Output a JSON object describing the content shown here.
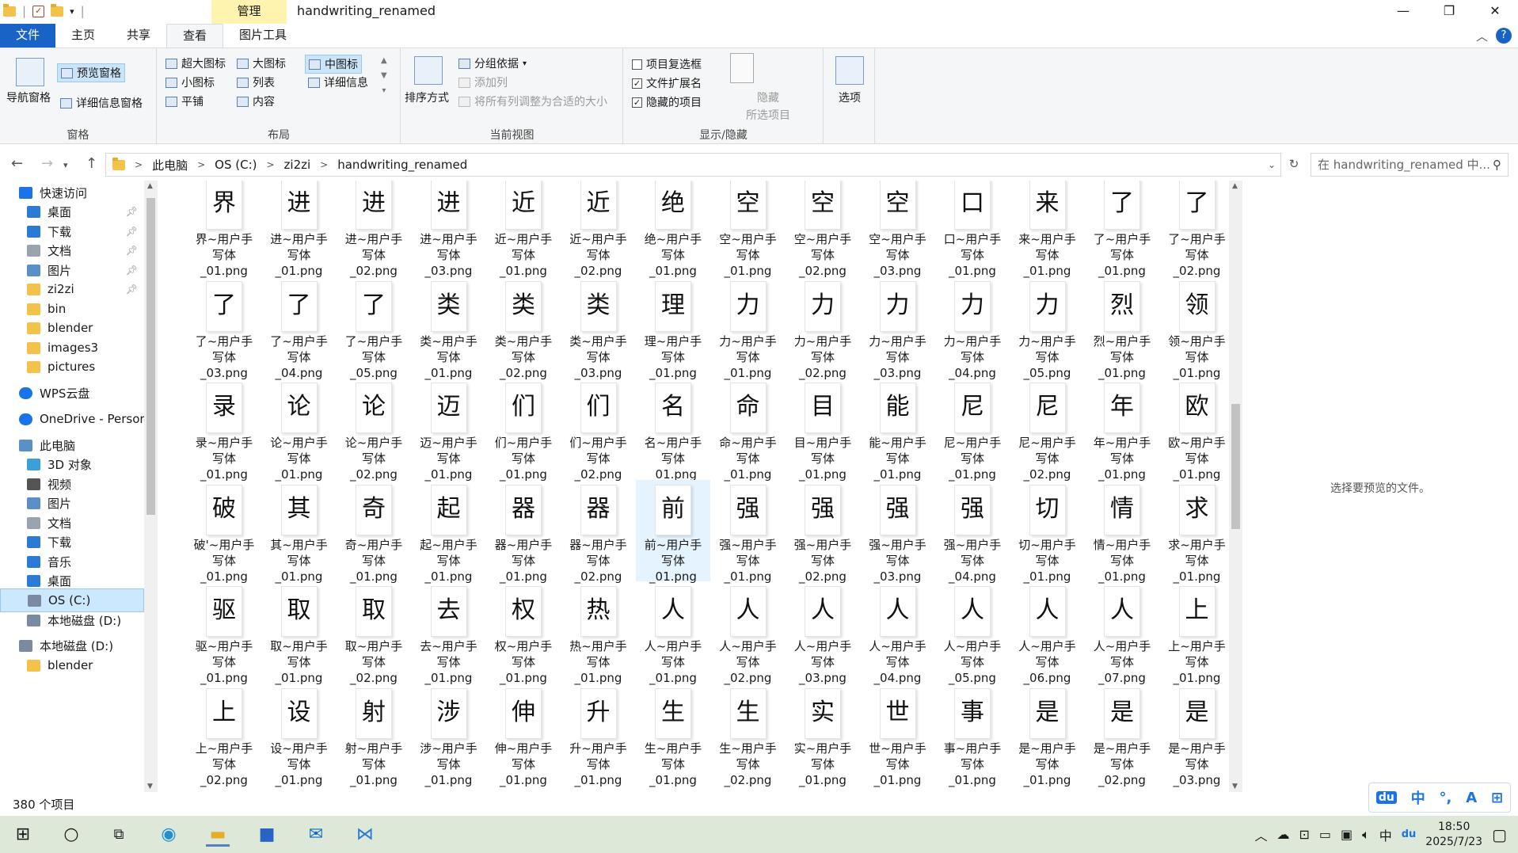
{
  "titlebar": {
    "manage_tab": "管理",
    "title": "handwriting_renamed",
    "minimize": "—",
    "maximize": "❐",
    "close": "✕"
  },
  "tabs": [
    {
      "label": "文件"
    },
    {
      "label": "主页"
    },
    {
      "label": "共享"
    },
    {
      "label": "查看"
    },
    {
      "label": "图片工具"
    }
  ],
  "ribbon": {
    "pane": {
      "nav_pane": "导航窗格",
      "preview_pane": "预览窗格",
      "details_pane": "详细信息窗格",
      "group_label": "窗格"
    },
    "layout": {
      "extra_large": "超大图标",
      "large": "大图标",
      "medium": "中图标",
      "small": "小图标",
      "list": "列表",
      "details": "详细信息",
      "tiles": "平铺",
      "content": "内容",
      "group_label": "布局"
    },
    "current_view": {
      "sort_by": "排序方式",
      "group_by": "分组依据",
      "add_column": "添加列",
      "fit_columns": "将所有列调整为合适的大小",
      "group_label": "当前视图"
    },
    "show_hide": {
      "item_checkboxes": "项目复选框",
      "file_extensions": "文件扩展名",
      "hidden_items": "隐藏的项目",
      "hide_selected_1": "隐藏",
      "hide_selected_2": "所选项目",
      "group_label": "显示/隐藏"
    },
    "options": "选项"
  },
  "address": {
    "crumbs": [
      "此电脑",
      "OS (C:)",
      "zi2zi",
      "handwriting_renamed"
    ],
    "search_placeholder": "在 handwriting_renamed 中..."
  },
  "sidebar": [
    {
      "label": "快速访问",
      "icon": "star-icon",
      "indent": 0,
      "pinned": false
    },
    {
      "label": "桌面",
      "icon": "desktop-icon",
      "indent": 1,
      "pinned": true
    },
    {
      "label": "下载",
      "icon": "download-icon",
      "indent": 1,
      "pinned": true
    },
    {
      "label": "文档",
      "icon": "document-icon",
      "indent": 1,
      "pinned": true
    },
    {
      "label": "图片",
      "icon": "picture-icon",
      "indent": 1,
      "pinned": true
    },
    {
      "label": "zi2zi",
      "icon": "folder-icon",
      "indent": 1,
      "pinned": true
    },
    {
      "label": "bin",
      "icon": "folder-icon",
      "indent": 1,
      "pinned": false
    },
    {
      "label": "blender",
      "icon": "folder-icon",
      "indent": 1,
      "pinned": false
    },
    {
      "label": "images3",
      "icon": "folder-icon",
      "indent": 1,
      "pinned": false
    },
    {
      "label": "pictures",
      "icon": "folder-icon",
      "indent": 1,
      "pinned": false
    },
    {
      "label": "WPS云盘",
      "icon": "cloud-icon",
      "indent": 0,
      "pinned": false
    },
    {
      "label": "OneDrive - Persor",
      "icon": "cloud-icon",
      "indent": 0,
      "pinned": false
    },
    {
      "label": "此电脑",
      "icon": "computer-icon",
      "indent": 0,
      "pinned": false
    },
    {
      "label": "3D 对象",
      "icon": "cube-icon",
      "indent": 1,
      "pinned": false
    },
    {
      "label": "视频",
      "icon": "video-icon",
      "indent": 1,
      "pinned": false
    },
    {
      "label": "图片",
      "icon": "picture-icon",
      "indent": 1,
      "pinned": false
    },
    {
      "label": "文档",
      "icon": "document-icon",
      "indent": 1,
      "pinned": false
    },
    {
      "label": "下载",
      "icon": "download-icon",
      "indent": 1,
      "pinned": false
    },
    {
      "label": "音乐",
      "icon": "music-icon",
      "indent": 1,
      "pinned": false
    },
    {
      "label": "桌面",
      "icon": "desktop-icon",
      "indent": 1,
      "pinned": false
    },
    {
      "label": "OS (C:)",
      "icon": "drive-icon",
      "indent": 1,
      "pinned": false,
      "selected": true
    },
    {
      "label": "本地磁盘 (D:)",
      "icon": "drive-icon",
      "indent": 1,
      "pinned": false
    },
    {
      "label": "本地磁盘 (D:)",
      "icon": "drive-icon",
      "indent": 0,
      "pinned": false
    },
    {
      "label": "blender",
      "icon": "folder-icon",
      "indent": 1,
      "pinned": false
    }
  ],
  "files": [
    [
      "界",
      "界~用户手写体_01.png"
    ],
    [
      "进",
      "进~用户手写体_01.png"
    ],
    [
      "进",
      "进~用户手写体_02.png"
    ],
    [
      "进",
      "进~用户手写体_03.png"
    ],
    [
      "近",
      "近~用户手写体_01.png"
    ],
    [
      "近",
      "近~用户手写体_02.png"
    ],
    [
      "绝",
      "绝~用户手写体_01.png"
    ],
    [
      "空",
      "空~用户手写体_01.png"
    ],
    [
      "空",
      "空~用户手写体_02.png"
    ],
    [
      "空",
      "空~用户手写体_03.png"
    ],
    [
      "口",
      "口~用户手写体_01.png"
    ],
    [
      "来",
      "来~用户手写体_01.png"
    ],
    [
      "了",
      "了~用户手写体_01.png"
    ],
    [
      "了",
      "了~用户手写体_02.png"
    ],
    [
      "了",
      "了~用户手写体_03.png"
    ],
    [
      "了",
      "了~用户手写体_04.png"
    ],
    [
      "了",
      "了~用户手写体_05.png"
    ],
    [
      "类",
      "类~用户手写体_01.png"
    ],
    [
      "类",
      "类~用户手写体_02.png"
    ],
    [
      "类",
      "类~用户手写体_03.png"
    ],
    [
      "理",
      "理~用户手写体_01.png"
    ],
    [
      "力",
      "力~用户手写体_01.png"
    ],
    [
      "力",
      "力~用户手写体_02.png"
    ],
    [
      "力",
      "力~用户手写体_03.png"
    ],
    [
      "力",
      "力~用户手写体_04.png"
    ],
    [
      "力",
      "力~用户手写体_05.png"
    ],
    [
      "烈",
      "烈~用户手写体_01.png"
    ],
    [
      "领",
      "领~用户手写体_01.png"
    ],
    [
      "录",
      "录~用户手写体_01.png"
    ],
    [
      "论",
      "论~用户手写体_01.png"
    ],
    [
      "论",
      "论~用户手写体_02.png"
    ],
    [
      "迈",
      "迈~用户手写体_01.png"
    ],
    [
      "们",
      "们~用户手写体_01.png"
    ],
    [
      "们",
      "们~用户手写体_02.png"
    ],
    [
      "名",
      "名~用户手写体_01.png"
    ],
    [
      "命",
      "命~用户手写体_01.png"
    ],
    [
      "目",
      "目~用户手写体_01.png"
    ],
    [
      "能",
      "能~用户手写体_01.png"
    ],
    [
      "尼",
      "尼~用户手写体_01.png"
    ],
    [
      "尼",
      "尼~用户手写体_02.png"
    ],
    [
      "年",
      "年~用户手写体_01.png"
    ],
    [
      "欧",
      "欧~用户手写体_01.png"
    ],
    [
      "破",
      "破'~用户手写体_01.png"
    ],
    [
      "其",
      "其~用户手写体_01.png"
    ],
    [
      "奇",
      "奇~用户手写体_01.png"
    ],
    [
      "起",
      "起~用户手写体_01.png"
    ],
    [
      "器",
      "器~用户手写体_01.png"
    ],
    [
      "器",
      "器~用户手写体_02.png"
    ],
    [
      "前",
      "前~用户手写体_01.png"
    ],
    [
      "强",
      "强~用户手写体_01.png"
    ],
    [
      "强",
      "强~用户手写体_02.png"
    ],
    [
      "强",
      "强~用户手写体_03.png"
    ],
    [
      "强",
      "强~用户手写体_04.png"
    ],
    [
      "切",
      "切~用户手写体_01.png"
    ],
    [
      "情",
      "情~用户手写体_01.png"
    ],
    [
      "求",
      "求~用户手写体_01.png"
    ],
    [
      "驱",
      "驱~用户手写体_01.png"
    ],
    [
      "取",
      "取~用户手写体_01.png"
    ],
    [
      "取",
      "取~用户手写体_02.png"
    ],
    [
      "去",
      "去~用户手写体_01.png"
    ],
    [
      "权",
      "权~用户手写体_01.png"
    ],
    [
      "热",
      "热~用户手写体_01.png"
    ],
    [
      "人",
      "人~用户手写体_01.png"
    ],
    [
      "人",
      "人~用户手写体_02.png"
    ],
    [
      "人",
      "人~用户手写体_03.png"
    ],
    [
      "人",
      "人~用户手写体_04.png"
    ],
    [
      "人",
      "人~用户手写体_05.png"
    ],
    [
      "人",
      "人~用户手写体_06.png"
    ],
    [
      "人",
      "人~用户手写体_07.png"
    ],
    [
      "上",
      "上~用户手写体_01.png"
    ],
    [
      "上",
      "上~用户手写体_02.png"
    ],
    [
      "设",
      "设~用户手写体_01.png"
    ],
    [
      "射",
      "射~用户手写体_01.png"
    ],
    [
      "涉",
      "涉~用户手写体_01.png"
    ],
    [
      "伸",
      "伸~用户手写体_01.png"
    ],
    [
      "升",
      "升~用户手写体_01.png"
    ],
    [
      "生",
      "生~用户手写体_01.png"
    ],
    [
      "生",
      "生~用户手写体_02.png"
    ],
    [
      "实",
      "实~用户手写体_01.png"
    ],
    [
      "世",
      "世~用户手写体_01.png"
    ],
    [
      "事",
      "事~用户手写体_01.png"
    ],
    [
      "是",
      "是~用户手写体_01.png"
    ],
    [
      "是",
      "是~用户手写体_02.png"
    ],
    [
      "是",
      "是~用户手写体_03.png"
    ]
  ],
  "preview_text": "选择要预览的文件。",
  "status": "380 个项目",
  "ime": [
    "du",
    "中",
    "°,",
    "A",
    "⊞"
  ],
  "taskbar": {
    "clock_time": "18:50",
    "clock_date": "2025/7/23"
  }
}
